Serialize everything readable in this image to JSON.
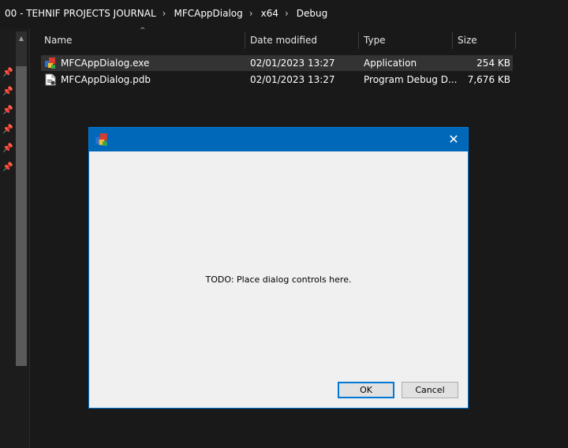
{
  "breadcrumb": [
    "00 - TEHNIF PROJECTS JOURNAL",
    "MFCAppDialog",
    "x64",
    "Debug"
  ],
  "columns": {
    "name": "Name",
    "date": "Date modified",
    "type": "Type",
    "size": "Size"
  },
  "files": [
    {
      "name": "MFCAppDialog.exe",
      "date": "02/01/2023 13:27",
      "type": "Application",
      "size": "254 KB",
      "icon": "exe-icon"
    },
    {
      "name": "MFCAppDialog.pdb",
      "date": "02/01/2023 13:27",
      "type": "Program Debug D...",
      "size": "7,676 KB",
      "icon": "pdb-icon"
    }
  ],
  "dialog": {
    "message": "TODO: Place dialog controls here.",
    "ok_label": "OK",
    "cancel_label": "Cancel",
    "close_glyph": "✕"
  },
  "colors": {
    "explorer_bg": "#191919",
    "dialog_title": "#0068b8",
    "dialog_body": "#f0f0f0",
    "accent": "#0078d7"
  }
}
